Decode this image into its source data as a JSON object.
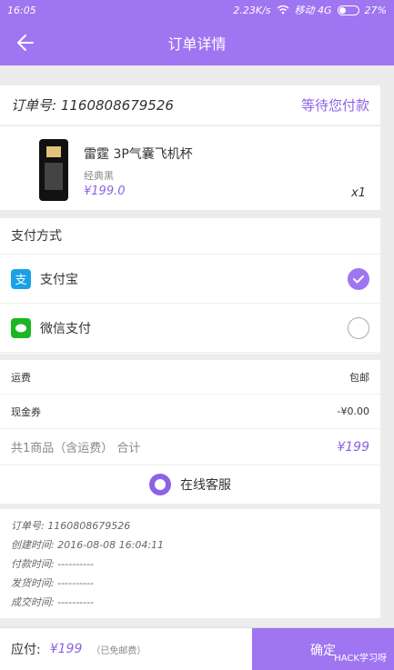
{
  "status_bar": {
    "time": "16:05",
    "speed": "2.23K/s",
    "carrier": "移动 4G",
    "battery": "27%"
  },
  "nav": {
    "title": "订单详情"
  },
  "order": {
    "number_label": "订单号:",
    "number": "1160808679526",
    "status": "等待您付款"
  },
  "product": {
    "title": "雷霆 3P气囊飞机杯",
    "spec": "经典黑",
    "price": "¥199.0",
    "qty": "x1"
  },
  "payment": {
    "title": "支付方式",
    "options": [
      {
        "label": "支付宝",
        "selected": true
      },
      {
        "label": "微信支付",
        "selected": false
      }
    ]
  },
  "summary": {
    "freight_label": "运费",
    "freight_value": "包邮",
    "coupon_label": "现金券",
    "coupon_value": "-¥0.00",
    "total_text": "共1商品（含运费）   合计",
    "total_value": "¥199",
    "service": "在线客服"
  },
  "times": [
    {
      "label": "订单号:",
      "value": "1160808679526"
    },
    {
      "label": "创建时间:",
      "value": "2016-08-08 16:04:11"
    },
    {
      "label": "付款时间:",
      "value": "----------"
    },
    {
      "label": "发货时间:",
      "value": "----------"
    },
    {
      "label": "成交时间:",
      "value": "----------"
    }
  ],
  "bottom": {
    "label": "应付:",
    "amount": "¥199",
    "note": "（已免邮费）",
    "confirm": "确定",
    "watermark": "HACK学习呀"
  },
  "colors": {
    "accent": "#9f75f1",
    "price": "#8b63e6"
  }
}
